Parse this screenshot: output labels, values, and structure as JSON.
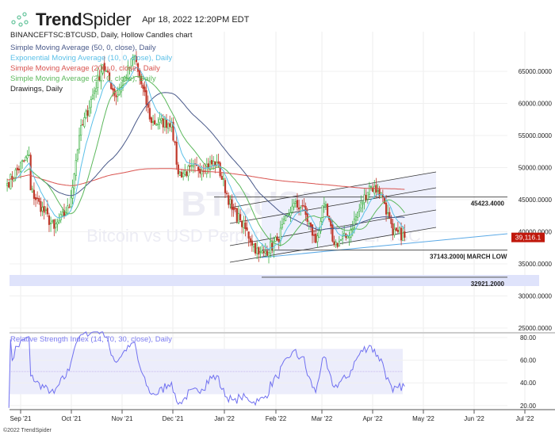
{
  "header": {
    "brand_bold": "Trend",
    "brand_light": "Spider",
    "datetime": "Apr 18, 2022 12:20PM EDT",
    "symbol_line": "BINANCEFTSC:BTCUSD, Daily, Hollow Candles chart"
  },
  "legend": [
    {
      "label": "Simple Moving Average (50, 0, close), Daily",
      "color": "#4a5a8a"
    },
    {
      "label": "Exponential Moving Average (10, 0, close), Daily",
      "color": "#5bc0e8"
    },
    {
      "label": "Simple Moving Average (200, 0, close), Daily",
      "color": "#d9534f"
    },
    {
      "label": "Simple Moving Average (21, 0, close), Daily",
      "color": "#5cb85c"
    },
    {
      "label": "Drawings, Daily",
      "color": "#222222"
    }
  ],
  "watermark": {
    "symbol": "BTCUSD",
    "name": "Bitcoin vs USD Perpetual - BINANCEFTSC"
  },
  "footer": "©2022 TrendSpider",
  "colors": {
    "up": "#3cb043",
    "down": "#c0392b",
    "price_tag": "#c0180c",
    "rsi": "#7070f0"
  },
  "chart_data": {
    "type": "candlestick",
    "title": "BINANCEFTSC:BTCUSD, Daily",
    "price_axis": {
      "ticks": [
        65000,
        60000,
        55000,
        50000,
        45000,
        40000,
        35000,
        30000,
        25000
      ],
      "tick_labels": [
        "65000.0000",
        "60000.0000",
        "55000.0000",
        "50000.0000",
        "45000.0000",
        "40000.0000",
        "35000.0000",
        "30000.0000",
        "25000.0000"
      ]
    },
    "time_axis": {
      "ticks": [
        "Sep '21",
        "Oct '21",
        "Nov '21",
        "Dec '21",
        "Jan '22",
        "Feb '22",
        "Mar '22",
        "Apr '22",
        "May '22",
        "Jun '22",
        "Jul '22"
      ]
    },
    "last_price": "39,116.1",
    "close_keyframes": [
      [
        "2021-08-24",
        47500
      ],
      [
        "2021-09-06",
        52000
      ],
      [
        "2021-09-07",
        46500
      ],
      [
        "2021-09-21",
        40500
      ],
      [
        "2021-09-30",
        43800
      ],
      [
        "2021-10-06",
        55000
      ],
      [
        "2021-10-20",
        66000
      ],
      [
        "2021-10-28",
        61000
      ],
      [
        "2021-11-08",
        67500
      ],
      [
        "2021-11-10",
        65000
      ],
      [
        "2021-11-18",
        57000
      ],
      [
        "2021-11-30",
        57000
      ],
      [
        "2021-12-04",
        49000
      ],
      [
        "2021-12-27",
        50800
      ],
      [
        "2022-01-05",
        43500
      ],
      [
        "2022-01-10",
        41800
      ],
      [
        "2022-01-21",
        36500
      ],
      [
        "2022-01-24",
        36700
      ],
      [
        "2022-02-01",
        38700
      ],
      [
        "2022-02-10",
        44000
      ],
      [
        "2022-02-16",
        44000
      ],
      [
        "2022-02-24",
        38300
      ],
      [
        "2022-03-01",
        44400
      ],
      [
        "2022-03-07",
        38000
      ],
      [
        "2022-03-15",
        39300
      ],
      [
        "2022-03-28",
        47100
      ],
      [
        "2022-04-02",
        46400
      ],
      [
        "2022-04-05",
        45500
      ],
      [
        "2022-04-11",
        39500
      ],
      [
        "2022-04-14",
        40000
      ],
      [
        "2022-04-18",
        39116
      ]
    ],
    "levels": [
      {
        "value": 45423.4,
        "label": "45423.4000"
      },
      {
        "value": 37143.2,
        "label": "37143.2000| MARCH LOW"
      },
      {
        "value": 32921.2,
        "label": "32921.2000"
      }
    ],
    "rsi": {
      "label": "Relative Strength Index (14, 70, 30, close), Daily",
      "ticks": [
        "80.00",
        "60.00",
        "40.00",
        "20.00"
      ],
      "band": [
        30,
        70
      ],
      "last": 38
    }
  }
}
